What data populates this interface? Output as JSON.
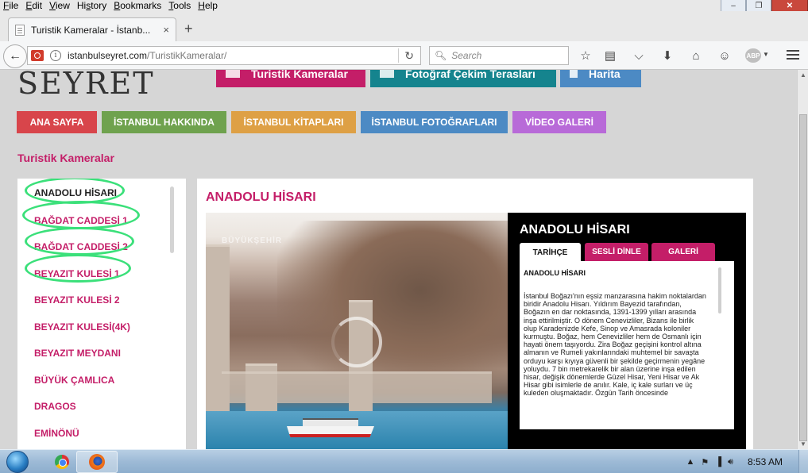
{
  "menubar": {
    "items": [
      {
        "label": "File",
        "accel": "F",
        "rest": "ile"
      },
      {
        "label": "Edit",
        "accel": "E",
        "rest": "dit"
      },
      {
        "label": "View",
        "accel": "V",
        "rest": "iew"
      },
      {
        "label": "History",
        "accel": "s",
        "pre": "Hi",
        "rest": "tory"
      },
      {
        "label": "Bookmarks",
        "accel": "B",
        "rest": "ookmarks"
      },
      {
        "label": "Tools",
        "accel": "T",
        "rest": "ools"
      },
      {
        "label": "Help",
        "accel": "H",
        "rest": "elp"
      }
    ]
  },
  "window_controls": {
    "minimize": "–",
    "restore": "❐",
    "close": "✕"
  },
  "tab": {
    "title": "Turistik Kameralar - İstanb...",
    "close": "×",
    "new_tab": "+"
  },
  "urlbar": {
    "domain": "istanbulseyret.com",
    "path": "/TuristikKameralar/"
  },
  "search": {
    "placeholder": "Search"
  },
  "toolbar_icons": [
    "star-icon",
    "reading-list-icon",
    "pocket-icon",
    "download-icon",
    "home-icon",
    "smiley-icon"
  ],
  "abp": {
    "label": "ABP"
  },
  "site": {
    "logo": "SEYRET",
    "top_buttons": [
      "Turistik Kameralar",
      "Fotoğraf Çekim Terasları",
      "Harita"
    ],
    "nav": [
      "ANA SAYFA",
      "İSTANBUL HAKKINDA",
      "İSTANBUL KİTAPLARI",
      "İSTANBUL FOTOĞRAFLARI",
      "VİDEO GALERİ"
    ],
    "section_title": "Turistik Kameralar",
    "cameras": [
      "ANADOLU HİSARI",
      "BAĞDAT CADDESİ 1",
      "BAĞDAT CADDESİ 2",
      "BEYAZIT KULESİ 1",
      "BEYAZIT KULESİ 2",
      "BEYAZIT KULESİ(4K)",
      "BEYAZIT MEYDANI",
      "BÜYÜK ÇAMLICA",
      "DRAGOS",
      "EMİNÖNÜ"
    ],
    "main_title": "ANADOLU HİSARI",
    "photo_watermark": "BÜYÜKŞEHİR",
    "info": {
      "title": "ANADOLU HİSARI",
      "tabs": [
        "TARİHÇE",
        "SESLİ DİNLE",
        "GALERİ"
      ],
      "heading": "ANADOLU HİSARI",
      "text": "İstanbul Boğazı'nın eşsiz manzarasına hakim noktalardan biridir Anadolu Hisarı. Yıldırım Bayezid tarafından, Boğazın en dar noktasında, 1391-1399 yılları arasında inşa ettirilmiştir. O dönem Cenevizliler, Bizans ile birlik olup Karadenizde Kefe, Sinop ve Amasrada koloniler kurmuştu. Boğaz, hem Cenevizliler hem de Osmanlı için hayati önem taşıyordu. Zira Boğaz geçişini kontrol altına almanın ve Rumeli yakınlarındaki muhtemel bir savaşta orduyu karşı kıyıya güvenli bir şekilde geçirmenin yegâne yoluydu. 7 bin metrekarelik bir alan üzerine inşa edilen hisar, değişik dönemlerde Güzel Hisar, Yeni Hisar ve Ak Hisar gibi isimlerle de anılır. Kale, iç kale surları ve üç kuleden oluşmaktadır. Özgün Tarih öncesinde"
    }
  },
  "taskbar": {
    "time": "8:53 AM"
  },
  "colors": {
    "brand_pink": "#c41e68",
    "annotation_green": "#3be07a"
  }
}
